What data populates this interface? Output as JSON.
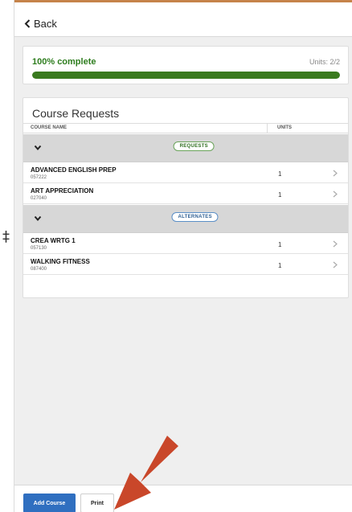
{
  "header": {
    "back_label": "Back"
  },
  "progress": {
    "label": "100% complete",
    "units_text": "Units: 2/2",
    "fraction": 1.0
  },
  "course_requests": {
    "title": "Course Requests",
    "columns": {
      "name": "COURSE NAME",
      "units": "UNITS"
    },
    "groups": [
      {
        "label": "REQUESTS",
        "rows": [
          {
            "name": "ADVANCED ENGLISH PREP",
            "code": "057222",
            "units": "1"
          },
          {
            "name": "ART APPRECIATION",
            "code": "027040",
            "units": "1"
          }
        ]
      },
      {
        "label": "ALTERNATES",
        "rows": [
          {
            "name": "CREA WRTG 1",
            "code": "057130",
            "units": "1"
          },
          {
            "name": "WALKING FITNESS",
            "code": "087400",
            "units": "1"
          }
        ]
      }
    ]
  },
  "footer": {
    "add_course_label": "Add Course",
    "print_label": "Print"
  },
  "left_edge_glyph": "‡",
  "colors": {
    "progress_fill": "#3a7a1f",
    "progress_label": "#2e7d1e",
    "add_button": "#2f6fc0",
    "requests_pill": "#6aa35a",
    "alternates_pill": "#5b8fc7",
    "annotation_arrow": "#c9472a",
    "top_accent": "#c6834a"
  },
  "icons": {
    "back": "chevron-left-icon",
    "group_toggle": "chevron-down-icon",
    "row_open": "chevron-right-icon",
    "annotation": "arrow-annotation-icon"
  }
}
